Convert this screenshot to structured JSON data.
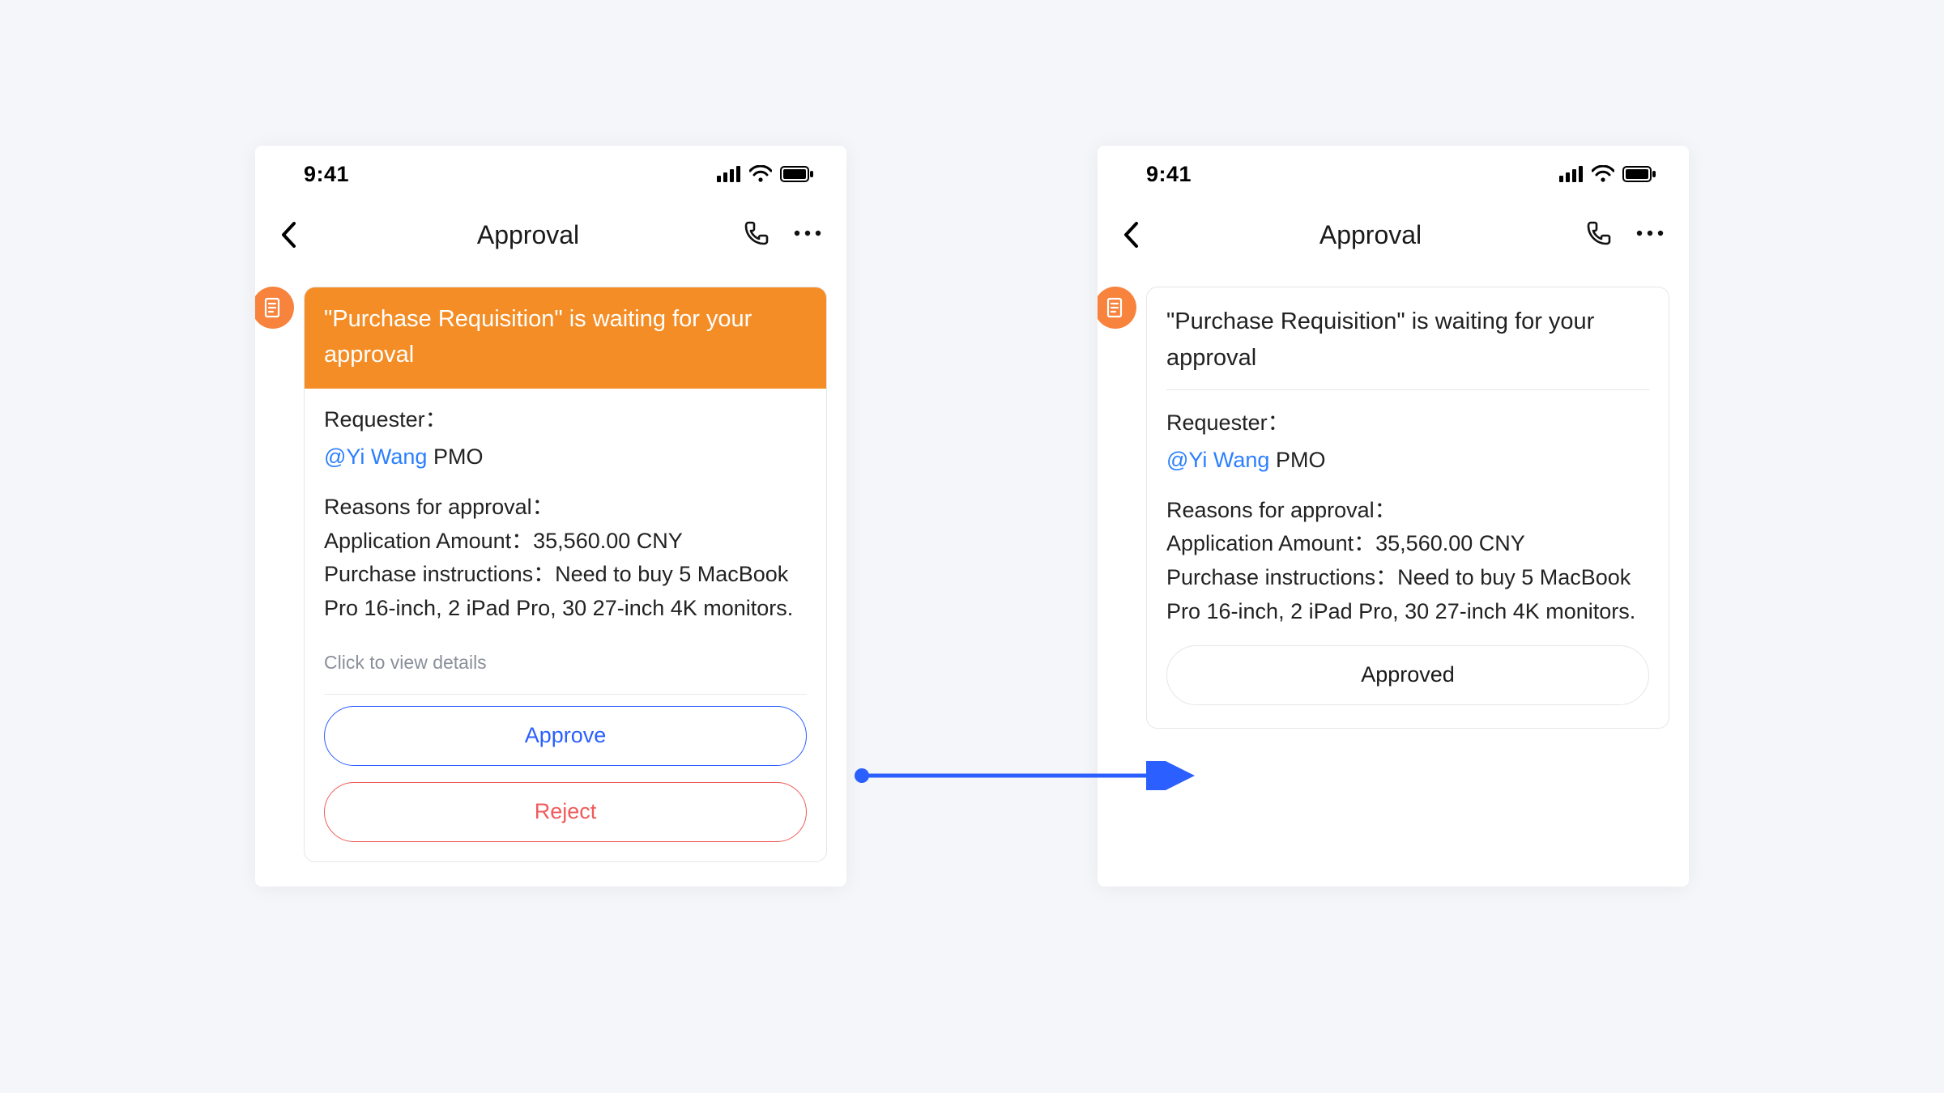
{
  "statusbar": {
    "time": "9:41"
  },
  "navbar": {
    "title": "Approval"
  },
  "card": {
    "title": "\"Purchase Requisition\" is waiting for your approval",
    "requester_label": "Requester：",
    "requester_mention": "@Yi Wang",
    "requester_role": "PMO",
    "reasons_label": "Reasons for approval：",
    "amount_line": "Application Amount：35,560.00 CNY",
    "instructions_line": "Purchase instructions：Need to buy 5 MacBook Pro 16-inch, 2 iPad Pro, 30 27-inch 4K monitors.",
    "details_link": "Click to view details"
  },
  "buttons": {
    "approve": "Approve",
    "reject": "Reject",
    "approved": "Approved"
  }
}
